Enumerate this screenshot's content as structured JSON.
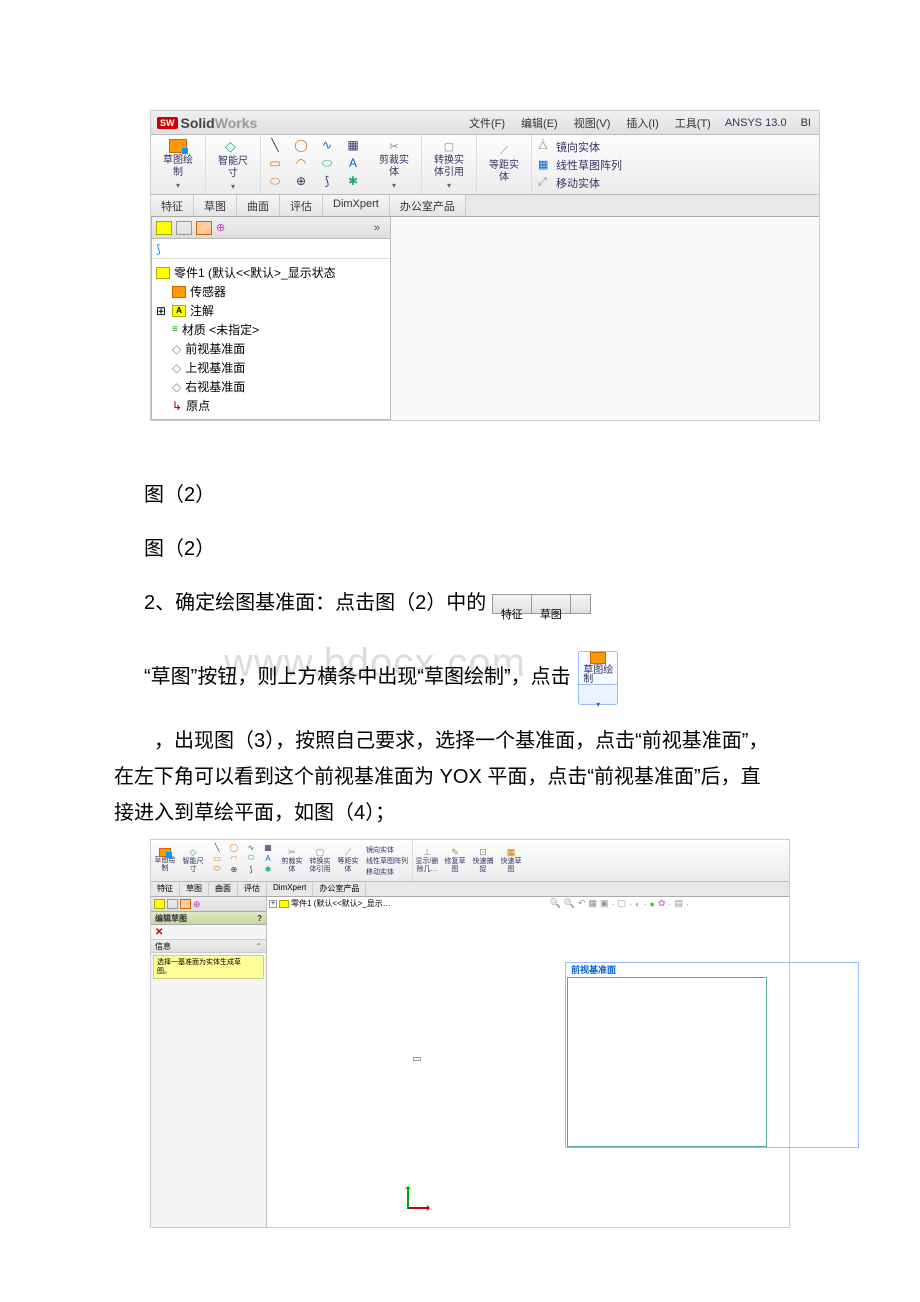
{
  "app": {
    "logo_badge": "SW",
    "logo_part1": "Solid",
    "logo_part2": "Works"
  },
  "menu": {
    "file": "文件(F)",
    "edit": "编辑(E)",
    "view": "视图(V)",
    "insert": "插入(I)",
    "tools": "工具(T)",
    "ansys": "ANSYS 13.0",
    "tail": "BI"
  },
  "ribbon": {
    "sketch_draw": "草图绘\n制",
    "smart_dim": "智能尺\n寸",
    "trim": "剪裁实\n体",
    "convert": "转换实\n体引用",
    "offset": "等距实\n体",
    "mirror": "镜向实体",
    "linear_pattern": "线性草图阵列",
    "move": "移动实体"
  },
  "tabs1": {
    "feature": "特征",
    "sketch": "草图",
    "surface": "曲面",
    "evaluate": "评估",
    "dimxpert": "DimXpert",
    "office": "办公室产品"
  },
  "tree": {
    "root": "零件1  (默认<<默认>_显示状态",
    "sensors": "传感器",
    "annotations": "注解",
    "material": "材质 <未指定>",
    "front_plane": "前视基准面",
    "top_plane": "上视基准面",
    "right_plane": "右视基准面",
    "origin": "原点"
  },
  "body": {
    "fig2a": "图（2）",
    "fig2b": "图（2）",
    "step2_pre": "2、确定绘图基准面：点击图（2）中的",
    "inline_feature": "特征",
    "inline_sketch": "草图",
    "watermark": "www.bdocx.com",
    "sketchbtn_label": "草图绘\n制",
    "line2": "“草图”按钮，则上方横条中出现“草图绘制”，点击",
    "para2": "，出现图（3），按照自己要求，选择一个基准面，点击“前视基准面”，在左下角可以看到这个前视基准面为 YOX 平面，点击“前视基准面”后，直接进入到草绘平面，如图（4）；"
  },
  "shot2": {
    "ribbon": {
      "sketch_draw": "草图绘\n制",
      "smart_dim": "智能尺\n寸",
      "trim": "剪裁实\n体",
      "convert": "转换实\n体引用",
      "offset": "等距实\n体",
      "mirror": "镜向实体",
      "linear_pattern": "线性草图阵列",
      "move": "移动实体",
      "show_del": "显示/删\n除几…",
      "repair": "修复草\n图",
      "quick_snap": "快速捕\n捉",
      "rapid_sketch": "快速草\n图"
    },
    "tabs": {
      "feature": "特征",
      "sketch": "草图",
      "surface": "曲面",
      "evaluate": "评估",
      "dimxpert": "DimXpert",
      "office": "办公室产品"
    },
    "left": {
      "edit_sketch": "编辑草图",
      "info": "信息",
      "hint": "选择一基准面为实体生成草\n图。"
    },
    "crumb": "零件1 (默认<<默认>_显示…",
    "plane_label": "前视基准面"
  }
}
